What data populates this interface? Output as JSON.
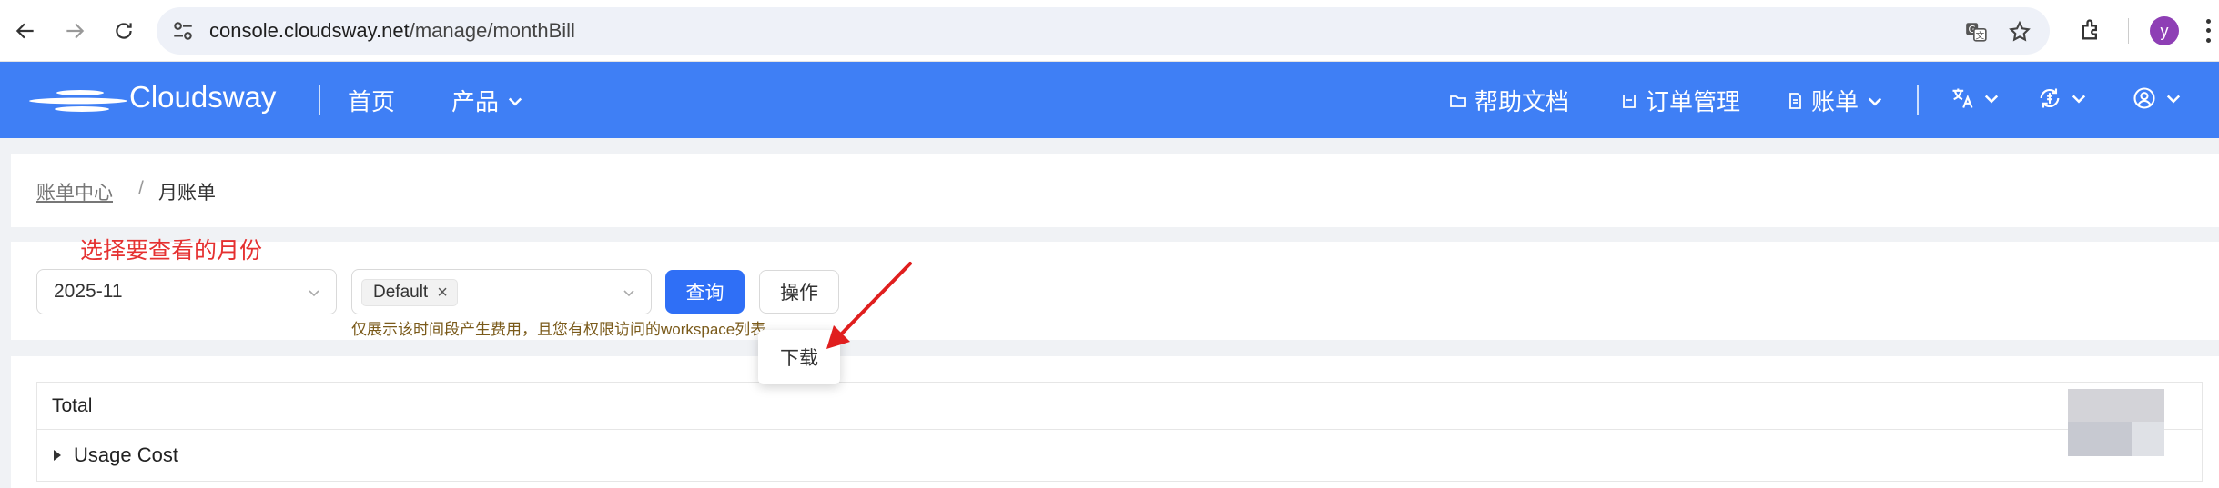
{
  "browser": {
    "url_host": "console.cloudsway.net",
    "url_path": "/manage/monthBill",
    "avatar_letter": "y",
    "icons": [
      "back-icon",
      "forward-icon",
      "reload-icon",
      "site-settings-icon",
      "translate-icon",
      "star-icon",
      "extensions-icon",
      "menu-icon"
    ]
  },
  "header": {
    "brand": "Cloudsway",
    "nav": {
      "home": "首页",
      "products": "产品"
    },
    "right": {
      "docs": "帮助文档",
      "orders": "订单管理",
      "billing": "账单"
    },
    "brand_color": "#3f7ff5"
  },
  "breadcrumb": {
    "root": "账单中心",
    "separator": "/",
    "current": "月账单"
  },
  "filters": {
    "annotation": "选择要查看的月份",
    "month_value": "2025-11",
    "workspace_tag": "Default",
    "query_button": "查询",
    "action_button": "操作",
    "hint": "仅展示该时间段产生费用，且您有权限访问的workspace列表"
  },
  "dropdown": {
    "download": "下载"
  },
  "table": {
    "header": "Total",
    "rows": [
      {
        "label": "Usage Cost"
      }
    ]
  },
  "colors": {
    "primary": "#2f6ff6",
    "annotation": "#e53030",
    "hint": "#7a5a1a"
  }
}
